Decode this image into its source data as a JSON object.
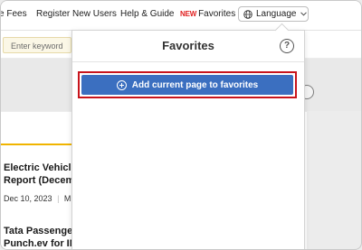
{
  "topbar": {
    "nav": {
      "fees": "e Fees",
      "register": "Register New Users",
      "help": "Help & Guide",
      "favorites_new_badge": "NEW",
      "favorites": "Favorites"
    },
    "language": {
      "label": "Language"
    }
  },
  "search": {
    "placeholder": "Enter keyword"
  },
  "articles": [
    {
      "title_line1": "Electric Vehicle",
      "title_line2": "Report (Decem",
      "date": "Dec 10, 2023",
      "source": "M"
    },
    {
      "title_line1": "Tata Passenge",
      "title_line2": "Punch.ev for IN"
    }
  ],
  "popup": {
    "title": "Favorites",
    "help_symbol": "?",
    "add_button_label": "Add current page to favorites"
  }
}
